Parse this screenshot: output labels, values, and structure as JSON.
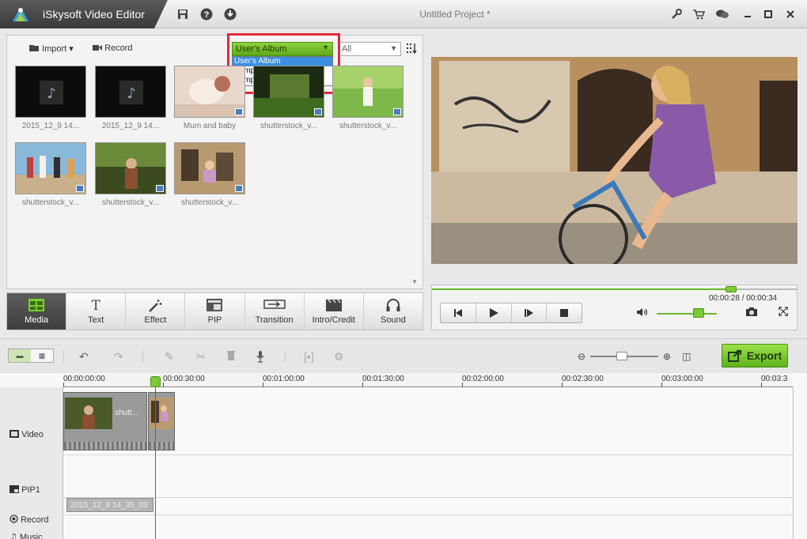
{
  "app": {
    "title": "iSkysoft Video Editor",
    "project_title": "Untitled Project *"
  },
  "titlebar_icons": [
    "save-icon",
    "help-icon",
    "download-icon",
    "tools-icon",
    "cart-icon",
    "chat-icon",
    "minimize-icon",
    "maximize-icon",
    "close-icon"
  ],
  "media": {
    "import_label": "Import",
    "record_label": "Record",
    "album_select": {
      "value": "User's Album",
      "options": [
        "User's Album",
        "Sample Colors",
        "Sample Video"
      ],
      "highlighted": "User's Album"
    },
    "filter_value": "All",
    "items": [
      {
        "label": "2015_12_9 14...",
        "kind": "audio"
      },
      {
        "label": "2015_12_9 14...",
        "kind": "audio"
      },
      {
        "label": "Mum and baby",
        "kind": "video"
      },
      {
        "label": "shutterstock_v...",
        "kind": "video"
      },
      {
        "label": "shutterstock_v...",
        "kind": "video"
      },
      {
        "label": "shutterstock_v...",
        "kind": "video"
      },
      {
        "label": "shutterstock_v...",
        "kind": "video"
      },
      {
        "label": "shutterstock_v...",
        "kind": "video"
      }
    ]
  },
  "categories": [
    {
      "label": "Media",
      "icon": "media-icon",
      "active": true
    },
    {
      "label": "Text",
      "icon": "text-icon",
      "active": false
    },
    {
      "label": "Effect",
      "icon": "effect-wand-icon",
      "active": false
    },
    {
      "label": "PIP",
      "icon": "pip-icon",
      "active": false
    },
    {
      "label": "Transition",
      "icon": "transition-icon",
      "active": false
    },
    {
      "label": "Intro/Credit",
      "icon": "clapper-icon",
      "active": false
    },
    {
      "label": "Sound",
      "icon": "headphones-icon",
      "active": false
    }
  ],
  "player": {
    "timecode": "00:00:28 / 00:00:34",
    "progress": 0.82,
    "volume": 0.7
  },
  "timeline": {
    "export_label": "Export",
    "ruler": [
      "00:00:00:00",
      "00:00:30:00",
      "00:01:00:00",
      "00:01:30:00",
      "00:02:00:00",
      "00:02:30:00",
      "00:03:00:00",
      "00:03:3"
    ],
    "tracks": {
      "video": "Video",
      "pip": "PIP1",
      "record": "Record",
      "music": "Music"
    },
    "video_clip_title": "shutt...",
    "record_clip_title": "2015_12_9 14_35_03"
  },
  "colors": {
    "accent_green": "#6ab82c",
    "highlight_red": "#e02a3c",
    "playhead": "#e03030"
  }
}
